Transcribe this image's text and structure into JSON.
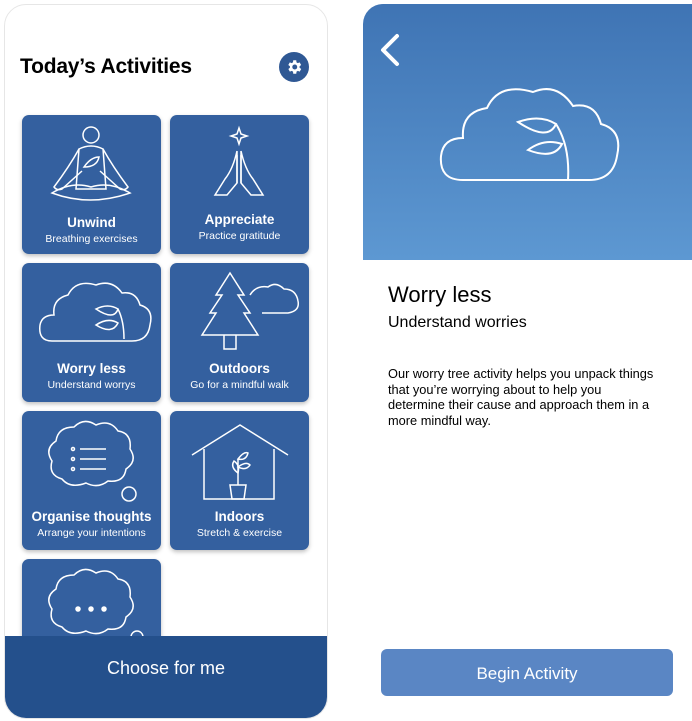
{
  "home": {
    "title": "Today’s Activities",
    "choose_label": "Choose for me",
    "activities": [
      {
        "title": "Unwind",
        "subtitle": "Breathing exercises",
        "icon": "meditation-icon"
      },
      {
        "title": "Appreciate",
        "subtitle": "Practice gratitude",
        "icon": "praying-hands-icon"
      },
      {
        "title": "Worry less",
        "subtitle": "Understand worrys",
        "icon": "cloud-leaf-icon"
      },
      {
        "title": "Outdoors",
        "subtitle": "Go for a mindful walk",
        "icon": "tree-icon"
      },
      {
        "title": "Organise thoughts",
        "subtitle": "Arrange your intentions",
        "icon": "thought-list-icon"
      },
      {
        "title": "Indoors",
        "subtitle": "Stretch & exercise",
        "icon": "house-plant-icon"
      },
      {
        "title": "",
        "subtitle": "",
        "icon": "thought-dots-icon"
      }
    ]
  },
  "detail": {
    "title": "Worry less",
    "subtitle": "Understand worries",
    "body": "Our worry tree activity helps you unpack things that you’re worrying about to help you determine their cause and approach them in a more mindful way.",
    "button_label": "Begin Activity"
  },
  "colors": {
    "tile": "#34609f",
    "button_dark": "#24508c",
    "button_light": "#5a86c4",
    "hero_top": "#3f74b4",
    "hero_bottom": "#5d98d2"
  }
}
